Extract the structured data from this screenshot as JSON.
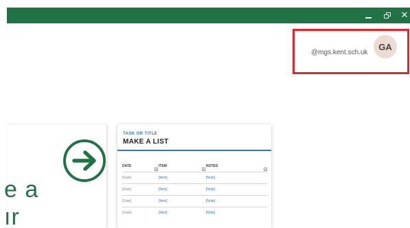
{
  "window": {
    "controls": {
      "minimize_icon": "minimize-icon",
      "restore_icon": "restore-icon",
      "close_label": "✕"
    },
    "accent": "#217346"
  },
  "account": {
    "email": "@mgs.kent.sch.uk",
    "initials": "GA",
    "highlight_color": "#e0262c"
  },
  "start": {
    "partial_line_1": "e a",
    "partial_line_2": "ır",
    "arrow_icon": "arrow-right-circle-icon"
  },
  "template": {
    "kicker": "TASK OR TITLE",
    "title": "MAKE A LIST",
    "columns": [
      "DATE",
      "ITEM",
      "NOTES"
    ],
    "rows": [
      [
        "[Date]",
        "[Item]",
        "[Note]"
      ],
      [
        "[Date]",
        "[Item]",
        "[Note]"
      ],
      [
        "[Date]",
        "[Item]",
        "[Note]"
      ],
      [
        "[Date]",
        "[Item]",
        "[Note]"
      ]
    ],
    "accent": "#2e75b6"
  }
}
